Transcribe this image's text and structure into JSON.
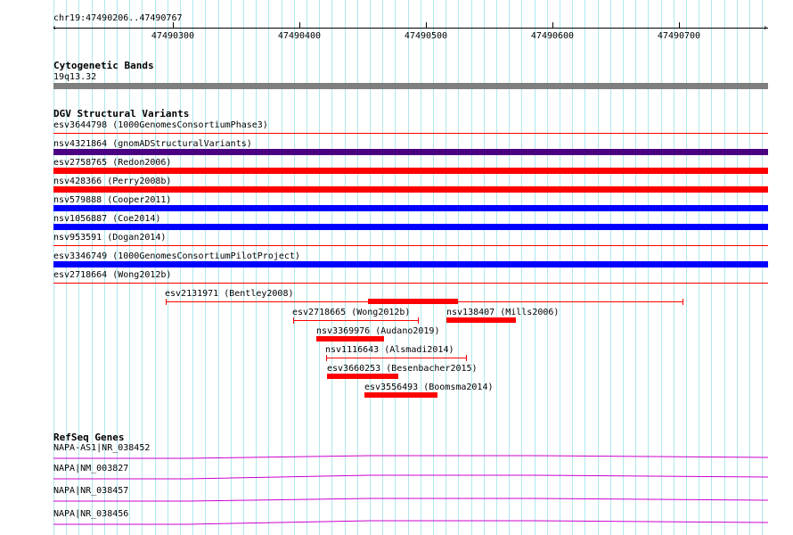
{
  "ruler": {
    "coords": "chr19:47490206..47490767",
    "ticks": [
      "47490300",
      "47490400",
      "47490500",
      "47490600",
      "47490700"
    ]
  },
  "cytoband": {
    "title": "Cytogenetic Bands",
    "band": "19q13.32",
    "color": "#7f7f7f"
  },
  "dgv": {
    "title": "DGV Structural Variants",
    "full_span": [
      {
        "label": "esv3644798 (1000GenomesConsortiumPhase3)",
        "color": "#ff0000",
        "style": "thin"
      },
      {
        "label": "nsv4321864 (gnomADStructuralVariants)",
        "color": "#4b0082",
        "style": "thick"
      },
      {
        "label": "esv2758765 (Redon2006)",
        "color": "#ff0000",
        "style": "thick"
      },
      {
        "label": "nsv428366 (Perry2008b)",
        "color": "#ff0000",
        "style": "thick"
      },
      {
        "label": "nsv579888 (Cooper2011)",
        "color": "#0000ff",
        "style": "thick"
      },
      {
        "label": "nsv1056887 (Coe2014)",
        "color": "#0000ff",
        "style": "thick"
      },
      {
        "label": "nsv953591 (Dogan2014)",
        "color": "#ff0000",
        "style": "thin"
      },
      {
        "label": "esv3346749 (1000GenomesConsortiumPilotProject)",
        "color": "#0000ff",
        "style": "thick"
      },
      {
        "label": "esv2718664 (Wong2012b)",
        "color": "#ff0000",
        "style": "thin"
      }
    ],
    "partial": [
      {
        "label": "esv2131971 (Bentley2008)"
      },
      {
        "label": "esv2718665 (Wong2012b)"
      },
      {
        "label": "nsv138407 (Mills2006)"
      },
      {
        "label": "nsv3369976 (Audano2019)"
      },
      {
        "label": "nsv1116643 (Alsmadi2014)"
      },
      {
        "label": "esv3660253 (Besenbacher2015)"
      },
      {
        "label": "esv3556493 (Boomsma2014)"
      }
    ]
  },
  "refseq": {
    "title": "RefSeq Genes",
    "color": "#cc00cc",
    "genes": [
      {
        "label": "NAPA-AS1|NR_038452"
      },
      {
        "label": "NAPA|NM_003827"
      },
      {
        "label": "NAPA|NR_038457"
      },
      {
        "label": "NAPA|NR_038456"
      }
    ]
  }
}
